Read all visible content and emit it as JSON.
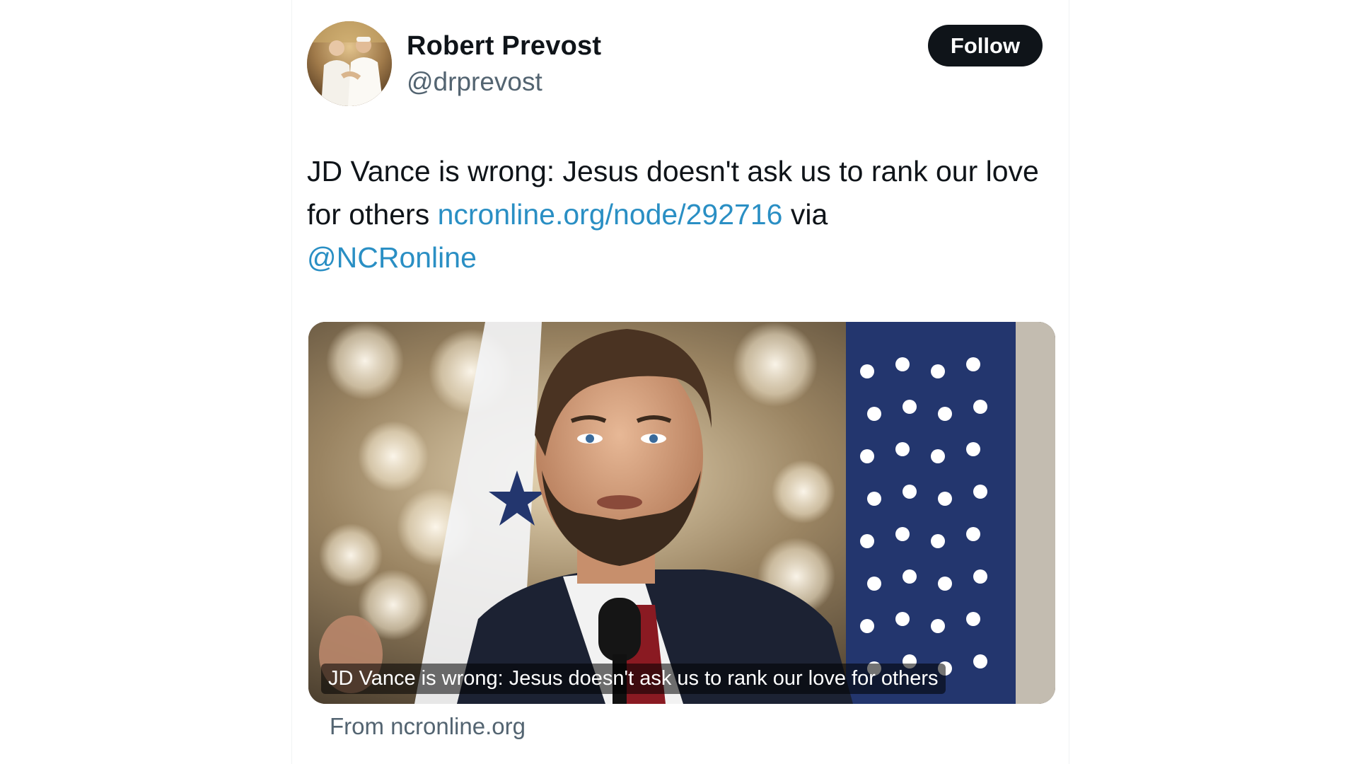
{
  "author": {
    "name": "Robert Prevost",
    "handle": "@drprevost"
  },
  "header": {
    "follow_label": "Follow"
  },
  "tweet": {
    "text_part1": "JD Vance is wrong: Jesus doesn't ask us to rank our love for others ",
    "link_url": "ncronline.org/node/292716",
    "text_via": " via ",
    "mention": "@NCRonline"
  },
  "card": {
    "title": "JD Vance is wrong: Jesus doesn't ask us to rank our love for others",
    "source": "From ncronline.org"
  },
  "colors": {
    "link": "#2a8fc4",
    "follow_bg": "#0f1419",
    "muted": "#536471"
  },
  "icons": {
    "avatar": "profile-photo",
    "card_image": "speaker-photo"
  }
}
